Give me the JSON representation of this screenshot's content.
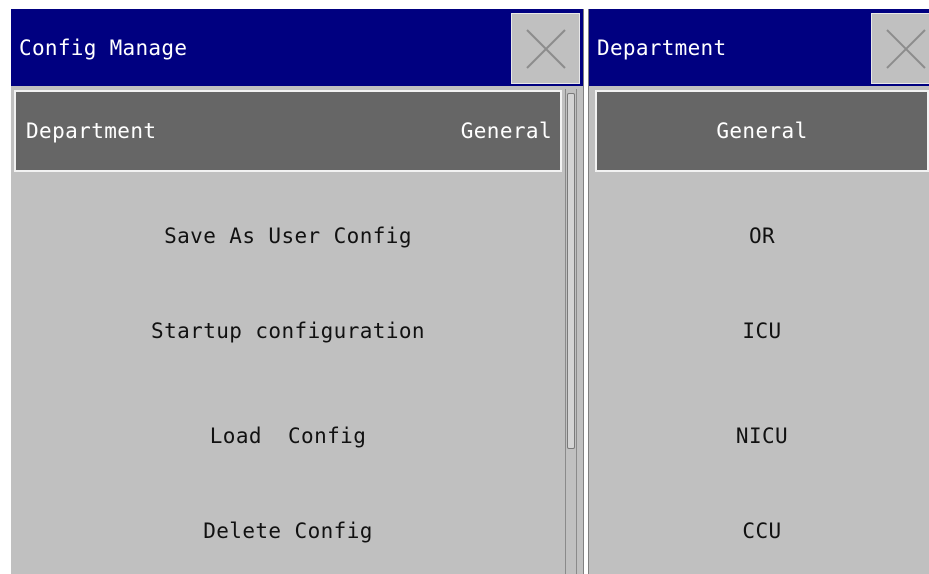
{
  "config_manage": {
    "title": "Config Manage",
    "close_icon": "close-x-icon",
    "items": [
      {
        "label": "Department",
        "value": "General"
      },
      {
        "label": "Save As User Config"
      },
      {
        "label": "Startup configuration"
      },
      {
        "label": "Load  Config"
      },
      {
        "label": "Delete Config"
      }
    ]
  },
  "department": {
    "title": "Department",
    "close_icon": "close-x-icon",
    "options": [
      "General",
      "OR",
      "ICU",
      "NICU",
      "CCU"
    ],
    "selected": "General"
  },
  "colors": {
    "title_bar": "#000080",
    "panel_bg": "#c0c0c0",
    "selected_bg": "#666666",
    "title_text": "#ffffff",
    "item_text": "#111111"
  }
}
